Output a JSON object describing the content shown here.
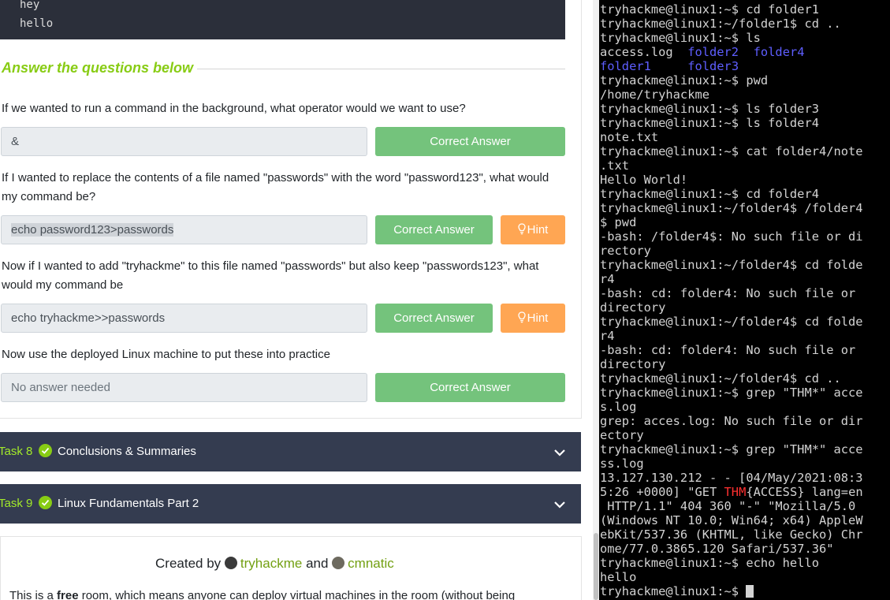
{
  "code_block": {
    "lines": [
      "hey",
      "hello"
    ]
  },
  "questions_heading": "Answer the questions below",
  "questions": [
    {
      "text": "If we wanted to run a command in the background, what operator would we want to use?",
      "answer": "&",
      "button": "Correct Answer"
    },
    {
      "text": "If I wanted to replace the contents of a file named \"passwords\" with the word \"password123\", what would my command be?",
      "answer": "echo password123>passwords",
      "button": "Correct Answer",
      "hint": "Hint"
    },
    {
      "text": "Now if I wanted to add \"tryhackme\" to this file named \"passwords\" but also keep \"passwords123\", what would my command be",
      "answer": "echo tryhackme>>passwords",
      "button": "Correct Answer",
      "hint": "Hint"
    },
    {
      "text": "Now use the deployed Linux machine to put these into practice",
      "answer_placeholder": "No answer needed",
      "button": "Correct Answer"
    }
  ],
  "tasks": [
    {
      "number": "Task 8",
      "title": "Conclusions & Summaries"
    },
    {
      "number": "Task 9",
      "title": "Linux Fundamentals Part 2"
    }
  ],
  "footer": {
    "created_by": "Created by",
    "author1": "tryhackme",
    "and": "and",
    "author2": "cmnatic",
    "text_pre": "This is a ",
    "text_bold": "free",
    "text_post": " room, which means anyone can deploy virtual machines in the room (without being"
  },
  "terminal": {
    "lines": [
      [
        {
          "t": "tryhackme@linux1:~$ cd folder1"
        }
      ],
      [
        {
          "t": "tryhackme@linux1:~/folder1$ cd .."
        }
      ],
      [
        {
          "t": "tryhackme@linux1:~$ ls"
        }
      ],
      [
        {
          "t": "access.log  "
        },
        {
          "t": "folder2",
          "c": "blue"
        },
        {
          "t": "  "
        },
        {
          "t": "folder4",
          "c": "blue"
        }
      ],
      [
        {
          "t": "folder1",
          "c": "blue"
        },
        {
          "t": "     "
        },
        {
          "t": "folder3",
          "c": "blue"
        }
      ],
      [
        {
          "t": "tryhackme@linux1:~$ pwd"
        }
      ],
      [
        {
          "t": "/home/tryhackme"
        }
      ],
      [
        {
          "t": "tryhackme@linux1:~$ ls folder3"
        }
      ],
      [
        {
          "t": "tryhackme@linux1:~$ ls folder4"
        }
      ],
      [
        {
          "t": "note.txt"
        }
      ],
      [
        {
          "t": "tryhackme@linux1:~$ cat folder4/note"
        }
      ],
      [
        {
          "t": ".txt"
        }
      ],
      [
        {
          "t": "Hello World!"
        }
      ],
      [
        {
          "t": "tryhackme@linux1:~$ cd folder4"
        }
      ],
      [
        {
          "t": "tryhackme@linux1:~/folder4$ /folder4"
        }
      ],
      [
        {
          "t": "$ pwd"
        }
      ],
      [
        {
          "t": "-bash: /folder4$: No such file or di"
        }
      ],
      [
        {
          "t": "rectory"
        }
      ],
      [
        {
          "t": "tryhackme@linux1:~/folder4$ cd folde"
        }
      ],
      [
        {
          "t": "r4"
        }
      ],
      [
        {
          "t": "-bash: cd: folder4: No such file or"
        }
      ],
      [
        {
          "t": "directory"
        }
      ],
      [
        {
          "t": "tryhackme@linux1:~/folder4$ cd folde"
        }
      ],
      [
        {
          "t": "r4"
        }
      ],
      [
        {
          "t": "-bash: cd: folder4: No such file or"
        }
      ],
      [
        {
          "t": "directory"
        }
      ],
      [
        {
          "t": "tryhackme@linux1:~/folder4$ cd .."
        }
      ],
      [
        {
          "t": "tryhackme@linux1:~$ grep \"THM*\" acce"
        }
      ],
      [
        {
          "t": "s.log"
        }
      ],
      [
        {
          "t": "grep: acces.log: No such file or dir"
        }
      ],
      [
        {
          "t": "ectory"
        }
      ],
      [
        {
          "t": "tryhackme@linux1:~$ grep \"THM*\" acce"
        }
      ],
      [
        {
          "t": "ss.log"
        }
      ],
      [
        {
          "t": "13.127.130.212 - - [04/May/2021:08:3"
        }
      ],
      [
        {
          "t": "5:26 +0000] \"GET "
        },
        {
          "t": "THM",
          "c": "red"
        },
        {
          "t": "{ACCESS} lang=en"
        }
      ],
      [
        {
          "t": " HTTP/1.1\" 404 360 \"-\" \"Mozilla/5.0"
        }
      ],
      [
        {
          "t": "(Windows NT 10.0; Win64; x64) AppleW"
        }
      ],
      [
        {
          "t": "ebKit/537.36 (KHTML, like Gecko) Chr"
        }
      ],
      [
        {
          "t": "ome/77.0.3865.120 Safari/537.36\""
        }
      ],
      [
        {
          "t": "tryhackme@linux1:~$ echo hello"
        }
      ],
      [
        {
          "t": "hello"
        }
      ],
      [
        {
          "t": "tryhackme@linux1:~$ "
        }
      ]
    ]
  },
  "colors": {
    "accent_green": "#88cc14",
    "correct_button": "#74c37c",
    "hint_button": "#ffa653",
    "task_bar": "#343c50",
    "terminal_bg": "#000000",
    "terminal_dir": "#5e5eff",
    "terminal_match": "#ff3030"
  },
  "icons": [
    "check-circle-icon",
    "chevron-down-icon",
    "lightbulb-icon",
    "avatar-icon"
  ]
}
